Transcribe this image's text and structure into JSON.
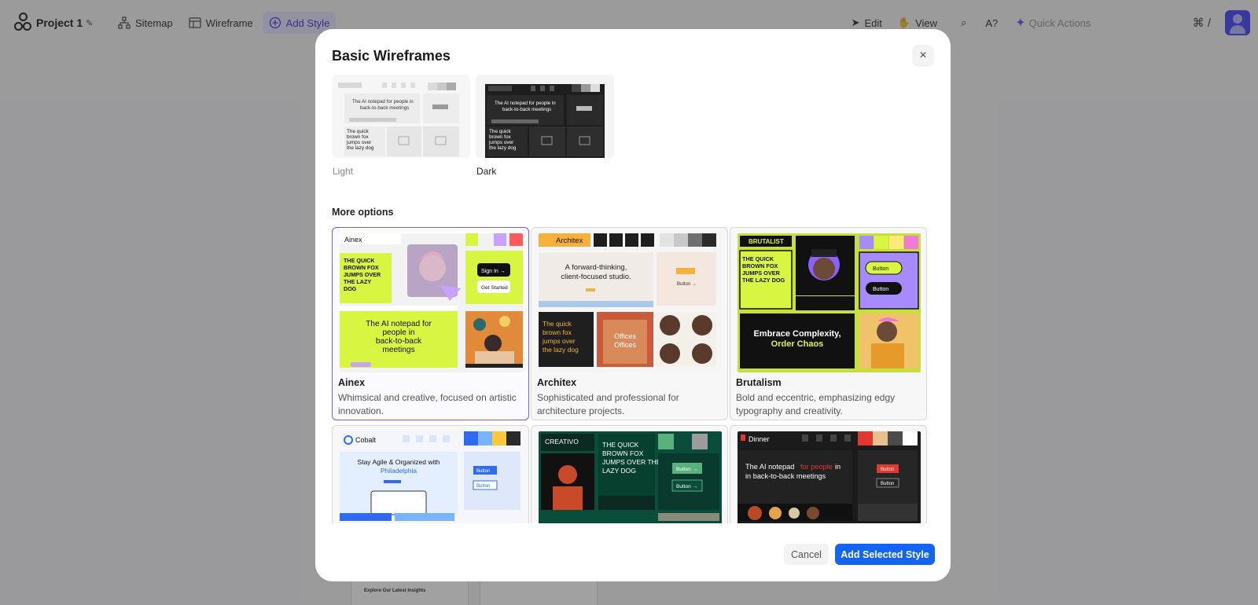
{
  "topbar": {
    "project_name": "Project 1",
    "sitemap_label": "Sitemap",
    "wireframe_label": "Wireframe",
    "add_style_label": "Add Style",
    "edit_label": "Edit",
    "view_label": "View",
    "quick_actions_placeholder": "Quick Actions",
    "shortcut": "⌘ /"
  },
  "background": {
    "card_text": "Explore Our Latest Insights"
  },
  "modal": {
    "title": "Basic Wireframes",
    "basic_styles": [
      {
        "label": "Light",
        "hero_text": "The AI notepad for people in back-to-back meetings",
        "body_text": "The quick brown fox jumps over the lazy dog"
      },
      {
        "label": "Dark",
        "hero_text": "The AI notepad for people in back-to-back meetings",
        "body_text": "The quick brown fox jumps over the lazy dog"
      }
    ],
    "more_options_label": "More options",
    "styles": [
      {
        "name": "Ainex",
        "description": "Whimsical and creative, focused on artistic innovation.",
        "selected": true,
        "brand": "Ainex",
        "headline": "THE QUICK BROWN FOX JUMPS OVER THE LAZY DOG",
        "hero": "The AI notepad for people in back-to-back meetings",
        "btn1": "Sign In →",
        "btn2": "Get Started",
        "colors": [
          "#d8f542",
          "#c9a2ff",
          "#ff5b5b"
        ]
      },
      {
        "name": "Architex",
        "description": "Sophisticated and professional for architecture projects.",
        "selected": false,
        "brand": "Architex",
        "headline": "A forward-thinking, client-focused studio.",
        "hero": "The quick brown fox jumps over the lazy dog",
        "btn1": "Button →",
        "card_word": "Offices",
        "colors": [
          "#e3e3e3",
          "#c8c8c8",
          "#6e6e6e",
          "#2a2a2a"
        ]
      },
      {
        "name": "Brutalism",
        "description": "Bold and eccentric, emphasizing edgy typography and creativity.",
        "selected": false,
        "brand": "BRUTALIST",
        "headline": "THE QUICK BROWN FOX JUMPS OVER THE LAZY DOG",
        "hero": "Embrace Complexity,",
        "hero2": "Order Chaos",
        "btn1": "Button",
        "btn2": "Button",
        "colors": [
          "#a58bff",
          "#d8f542",
          "#f07ad8"
        ]
      },
      {
        "name": "Cobalt",
        "description": "",
        "selected": false,
        "brand": "Cobalt",
        "headline": "Stay Agile & Organized with",
        "headline2": "Philadelphia",
        "btn1": "Button",
        "btn2": "Button",
        "colors": [
          "#2f6bf2",
          "#79b3ff",
          "#ffc83a",
          "#2a2a2a"
        ]
      },
      {
        "name": "Creativo",
        "description": "",
        "selected": false,
        "brand": "CREATIVO",
        "headline": "THE QUICK BROWN FOX JUMPS OVER THE LAZY DOG",
        "btn1": "Button →",
        "btn2": "Button →",
        "colors": [
          "#59b27b",
          "#0b4d3b",
          "#9c9c9c"
        ]
      },
      {
        "name": "Dinner",
        "description": "",
        "selected": false,
        "brand": "Dinner",
        "headline": "The AI notepad",
        "headline_accent": "for people",
        "headline3": "in back-to-back meetings",
        "btn1": "Button",
        "btn2": "Button",
        "colors": [
          "#e3372f",
          "#e7c18c",
          "#4b4b4b",
          "#ffffff"
        ]
      }
    ],
    "cancel_label": "Cancel",
    "add_label": "Add Selected Style"
  }
}
